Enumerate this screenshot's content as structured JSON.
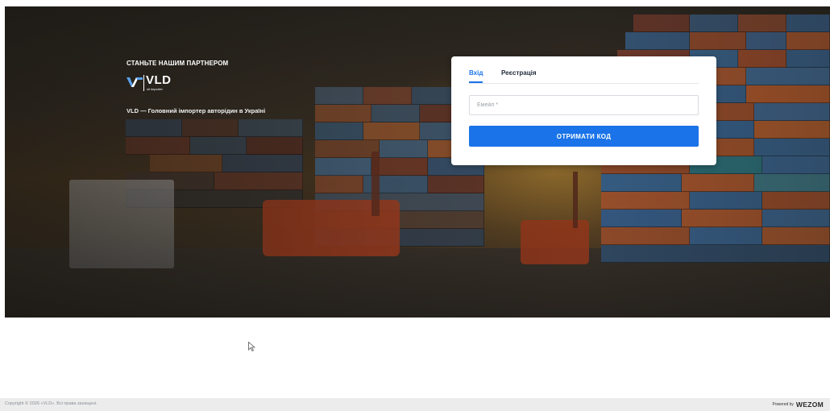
{
  "hero": {
    "tagline": "СТАНЬТЕ НАШИМ ПАРТНЕРОМ",
    "logo_name": "VLD",
    "logo_sub": "oil importer",
    "description": "VLD — Головний імпортер авторідин в Україні"
  },
  "auth": {
    "tab_login": "Вхід",
    "tab_register": "Реєстрація",
    "email_placeholder": "Емейл *",
    "email_value": "",
    "submit_label": "ОТРИМАТИ КОД"
  },
  "footer": {
    "copyright": "Copyright © 2026 «VLD». Всі права захищені.",
    "powered_label": "Powered by",
    "powered_brand": "WEZOM"
  },
  "colors": {
    "accent": "#1a73e8",
    "footer_bg": "#ececec"
  },
  "icons": {
    "logo": "vld-logo-icon",
    "cursor": "mouse-pointer-icon"
  }
}
